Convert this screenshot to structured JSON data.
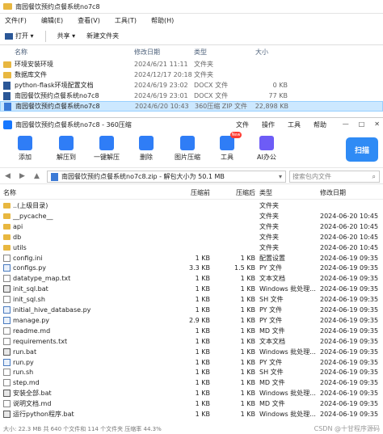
{
  "explorer": {
    "title": "南园餐饮预约点餐系统no7c8",
    "menu": [
      "文件(F)",
      "编辑(E)",
      "查看(V)",
      "工具(T)",
      "帮助(H)"
    ],
    "toolbar": {
      "open": "打开",
      "share": "共享",
      "new_folder": "新建文件夹"
    },
    "columns": {
      "name": "名称",
      "modified": "修改日期",
      "type": "类型",
      "size": "大小"
    },
    "rows": [
      {
        "name": "环境安装环境",
        "modified": "2024/6/21 11:11",
        "type": "文件夹",
        "size": ""
      },
      {
        "name": "数据库文件",
        "modified": "2024/12/17 20:18",
        "type": "文件夹",
        "size": ""
      },
      {
        "name": "python-flask环境配置文档",
        "modified": "2024/6/19 23:02",
        "type": "DOCX 文件",
        "size": "0 KB"
      },
      {
        "name": "南园餐饮预约点餐系统no7c8",
        "modified": "2024/6/19 23:01",
        "type": "DOCX 文件",
        "size": "77 KB"
      },
      {
        "name": "南园餐饮预约点餐系统no7c8",
        "modified": "2024/6/20 10:43",
        "type": "360压缩 ZIP 文件",
        "size": "22,898 KB"
      }
    ]
  },
  "zip": {
    "title": "南园餐饮预约点餐系统no7c8 - 360压缩",
    "title_menu": [
      "文件",
      "操作",
      "工具",
      "帮助"
    ],
    "win_controls": {
      "min": "—",
      "max": "□",
      "close": "✕"
    },
    "toolbar": [
      {
        "label": "添加",
        "color": "#2f7df6"
      },
      {
        "label": "解压到",
        "color": "#2f7df6"
      },
      {
        "label": "一键解压",
        "color": "#2f7df6"
      },
      {
        "label": "删除",
        "color": "#2f7df6"
      },
      {
        "label": "图片压缩",
        "color": "#2f7df6"
      },
      {
        "label": "工具",
        "color": "#2f7df6"
      },
      {
        "label": "AI办公",
        "color": "#6d5cf6"
      }
    ],
    "new_badge": "New",
    "scan_label": "扫描",
    "path": "南园餐饮预约点餐系统no7c8.zip - 解包大小为 50.1 MB",
    "search_placeholder": "搜索包内文件",
    "columns": {
      "name": "名称",
      "compressed": "压缩前",
      "packed": "压缩后",
      "type": "类型",
      "modified": "修改日期"
    },
    "rows": [
      {
        "name": "..(上级目录)",
        "compressed": "",
        "packed": "",
        "type": "文件夹",
        "modified": "",
        "kind": "folder"
      },
      {
        "name": "__pycache__",
        "compressed": "",
        "packed": "",
        "type": "文件夹",
        "modified": "2024-06-20 10:45",
        "kind": "folder"
      },
      {
        "name": "api",
        "compressed": "",
        "packed": "",
        "type": "文件夹",
        "modified": "2024-06-20 10:45",
        "kind": "folder"
      },
      {
        "name": "db",
        "compressed": "",
        "packed": "",
        "type": "文件夹",
        "modified": "2024-06-20 10:45",
        "kind": "folder"
      },
      {
        "name": "utils",
        "compressed": "",
        "packed": "",
        "type": "文件夹",
        "modified": "2024-06-20 10:45",
        "kind": "folder"
      },
      {
        "name": "config.ini",
        "compressed": "1 KB",
        "packed": "1 KB",
        "type": "配置设置",
        "modified": "2024-06-19 09:35",
        "kind": "file"
      },
      {
        "name": "configs.py",
        "compressed": "3.3 KB",
        "packed": "1.5 KB",
        "type": "PY 文件",
        "modified": "2024-06-19 09:35",
        "kind": "py"
      },
      {
        "name": "datatype_map.txt",
        "compressed": "1 KB",
        "packed": "1 KB",
        "type": "文本文档",
        "modified": "2024-06-19 09:35",
        "kind": "file"
      },
      {
        "name": "init_sql.bat",
        "compressed": "1 KB",
        "packed": "1 KB",
        "type": "Windows 批处理...",
        "modified": "2024-06-19 09:35",
        "kind": "bat"
      },
      {
        "name": "init_sql.sh",
        "compressed": "1 KB",
        "packed": "1 KB",
        "type": "SH 文件",
        "modified": "2024-06-19 09:35",
        "kind": "file"
      },
      {
        "name": "initial_hive_database.py",
        "compressed": "1 KB",
        "packed": "1 KB",
        "type": "PY 文件",
        "modified": "2024-06-19 09:35",
        "kind": "py"
      },
      {
        "name": "manage.py",
        "compressed": "2.9 KB",
        "packed": "1 KB",
        "type": "PY 文件",
        "modified": "2024-06-19 09:35",
        "kind": "py"
      },
      {
        "name": "readme.md",
        "compressed": "1 KB",
        "packed": "1 KB",
        "type": "MD 文件",
        "modified": "2024-06-19 09:35",
        "kind": "file"
      },
      {
        "name": "requirements.txt",
        "compressed": "1 KB",
        "packed": "1 KB",
        "type": "文本文档",
        "modified": "2024-06-19 09:35",
        "kind": "file"
      },
      {
        "name": "run.bat",
        "compressed": "1 KB",
        "packed": "1 KB",
        "type": "Windows 批处理...",
        "modified": "2024-06-19 09:35",
        "kind": "bat"
      },
      {
        "name": "run.py",
        "compressed": "1 KB",
        "packed": "1 KB",
        "type": "PY 文件",
        "modified": "2024-06-19 09:35",
        "kind": "py"
      },
      {
        "name": "run.sh",
        "compressed": "1 KB",
        "packed": "1 KB",
        "type": "SH 文件",
        "modified": "2024-06-19 09:35",
        "kind": "file"
      },
      {
        "name": "step.md",
        "compressed": "1 KB",
        "packed": "1 KB",
        "type": "MD 文件",
        "modified": "2024-06-19 09:35",
        "kind": "file"
      },
      {
        "name": "安装全部.bat",
        "compressed": "1 KB",
        "packed": "1 KB",
        "type": "Windows 批处理...",
        "modified": "2024-06-19 09:35",
        "kind": "bat"
      },
      {
        "name": "说明文档.md",
        "compressed": "1 KB",
        "packed": "1 KB",
        "type": "MD 文件",
        "modified": "2024-06-19 09:35",
        "kind": "file"
      },
      {
        "name": "运行python程序.bat",
        "compressed": "1 KB",
        "packed": "1 KB",
        "type": "Windows 批处理...",
        "modified": "2024-06-19 09:35",
        "kind": "bat"
      }
    ],
    "status": "大小: 22.3 MB 共 640 个文件和 114 个文件夹 压缩率 44.3%",
    "watermark": "CSDN @十甘程序源码"
  }
}
